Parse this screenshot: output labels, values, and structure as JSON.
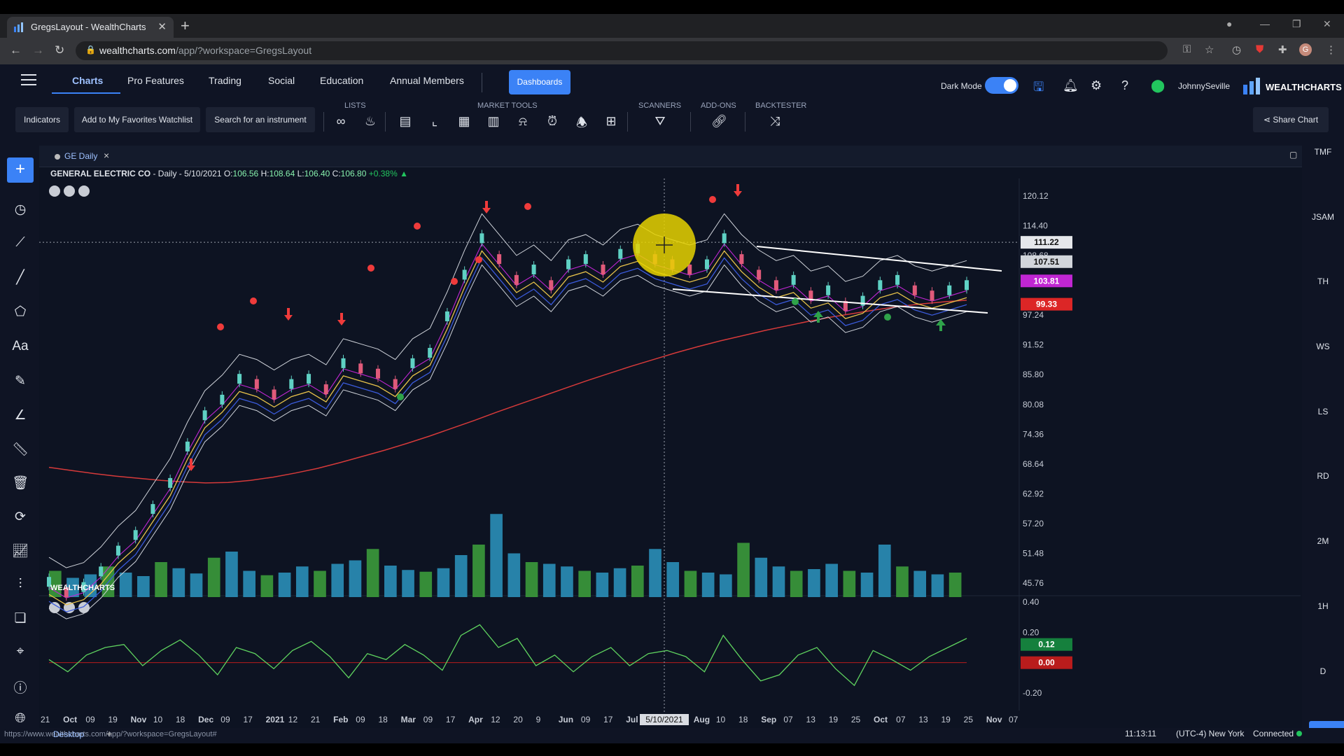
{
  "browser": {
    "tab_title": "GregsLayout - WealthCharts",
    "url_domain": "wealthcharts.com",
    "url_path": "/app/?workspace=GregsLayout",
    "tab_close": "✕",
    "new_tab": "+"
  },
  "header": {
    "nav": [
      "Charts",
      "Pro Features",
      "Trading",
      "Social",
      "Education",
      "Annual Members"
    ],
    "dashboards": "Dashboards",
    "dark_mode_label": "Dark Mode",
    "username": "JohnnySeville",
    "brand": "WEALTHCHARTS"
  },
  "toolbar": {
    "indicators": "Indicators",
    "favorites": "Add to My Favorites Watchlist",
    "search": "Search for an instrument",
    "lists_label": "LISTS",
    "market_tools_label": "MARKET TOOLS",
    "scanners_label": "SCANNERS",
    "addons_label": "ADD-ONS",
    "backtester_label": "BACKTESTER",
    "share_chart": "Share Chart"
  },
  "right_rail": [
    "TMF",
    "JSAM",
    "TH",
    "WS",
    "LS",
    "RD",
    "2M",
    "1H",
    "D"
  ],
  "chart_tab": {
    "name": "GE Daily",
    "close": "×"
  },
  "legend": {
    "name": "GENERAL ELECTRIC CO",
    "interval": " - Daily - 5/10/2021 ",
    "o_label": "O:",
    "o": "106.56",
    "h_label": "H:",
    "h": "108.64",
    "l_label": "L:",
    "l": "106.40",
    "c_label": "C:",
    "c": "106.80",
    "change": "+0.38%"
  },
  "watermark": "WEALTHCHARTS",
  "chart_data": {
    "type": "line",
    "price_axis": [
      "120.12",
      "114.40",
      "108.68",
      "97.24",
      "91.52",
      "85.80",
      "80.08",
      "74.36",
      "68.64",
      "62.92",
      "57.20",
      "51.48",
      "45.76"
    ],
    "oscillator_axis": [
      "0.40",
      "0.20",
      "-0.20"
    ],
    "x_ticks": [
      "21",
      "Oct",
      "09",
      "19",
      "Nov",
      "10",
      "18",
      "Dec",
      "09",
      "17",
      "2021",
      "12",
      "21",
      "Feb",
      "09",
      "18",
      "Mar",
      "09",
      "17",
      "Apr",
      "12",
      "20",
      "9",
      "Jun",
      "09",
      "17",
      "Jul",
      "12",
      "20",
      "Aug",
      "10",
      "18",
      "Sep",
      "07",
      "13",
      "19",
      "25",
      "Oct",
      "07",
      "13",
      "19",
      "25",
      "Nov",
      "07"
    ],
    "crosshair_date": "5/10/2021",
    "price_labels": [
      {
        "text": "111.22",
        "color": "#e5e7eb"
      },
      {
        "text": "107.51",
        "color": "#d1d5db"
      },
      {
        "text": "103.81",
        "color": "#c026d3"
      },
      {
        "text": "99.33",
        "color": "#dc2626"
      }
    ],
    "osc_labels": [
      {
        "text": "0.12",
        "color": "#15803d"
      },
      {
        "text": "0.00",
        "color": "#b91c1c"
      }
    ],
    "close_series": [
      46,
      44,
      45,
      48,
      52,
      55,
      60,
      65,
      72,
      78,
      81,
      85,
      84,
      82,
      84,
      85,
      83,
      88,
      87,
      86,
      84,
      88,
      90,
      97,
      105,
      112,
      108,
      104,
      106,
      103,
      107,
      108,
      106,
      109,
      110,
      108,
      107,
      106,
      107,
      112,
      108,
      105,
      103,
      104,
      101,
      102,
      99,
      100,
      103,
      104,
      102,
      101,
      102,
      103
    ],
    "ma200_series": [
      68.0,
      67.4,
      66.8,
      66.3,
      65.9,
      65.5,
      65.2,
      65.0,
      65.1,
      65.5,
      66.1,
      66.9,
      67.8,
      68.9,
      70.1,
      71.3,
      72.6,
      74.0,
      75.5,
      77.0,
      78.6,
      80.1,
      81.6,
      83.1,
      84.6,
      86.0,
      87.4,
      88.7,
      90.0,
      91.2,
      92.3,
      93.3,
      94.3,
      95.2,
      96.1,
      96.9,
      97.6,
      98.3,
      98.9,
      99.4,
      99.8,
      100.1
    ],
    "volume_series": [
      30,
      22,
      26,
      35,
      28,
      24,
      40,
      33,
      27,
      45,
      52,
      30,
      25,
      28,
      35,
      30,
      38,
      42,
      55,
      36,
      31,
      29,
      33,
      48,
      60,
      95,
      50,
      40,
      38,
      35,
      30,
      28,
      33,
      36,
      55,
      40,
      30,
      28,
      26,
      62,
      45,
      35,
      30,
      32,
      38,
      30,
      28,
      60,
      35,
      30,
      26,
      28
    ],
    "oscillator_series": [
      0.02,
      -0.06,
      0.05,
      0.1,
      0.12,
      -0.02,
      0.08,
      0.15,
      0.05,
      -0.08,
      0.1,
      0.06,
      -0.04,
      0.08,
      0.14,
      0.04,
      -0.1,
      0.06,
      0.02,
      0.12,
      0.05,
      -0.05,
      0.18,
      0.25,
      0.1,
      0.16,
      -0.02,
      0.05,
      -0.06,
      0.04,
      0.1,
      -0.02,
      0.06,
      0.08,
      0.04,
      -0.06,
      0.18,
      0.02,
      -0.12,
      -0.08,
      0.05,
      0.1,
      -0.04,
      -0.15,
      0.08,
      0.02,
      -0.05,
      0.04,
      0.1,
      0.16
    ]
  },
  "footer": {
    "status_url": "https://www.wealthcharts.com/app/?workspace=GregsLayout#",
    "desktop": "Desktop",
    "add": "+",
    "time": "11:13:11",
    "timezone": "(UTC-4) New York",
    "connected": "Connected"
  }
}
